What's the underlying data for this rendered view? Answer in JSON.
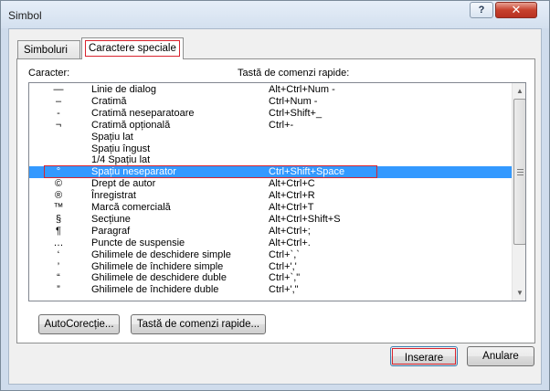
{
  "window": {
    "title": "Simbol",
    "help_label": "?",
    "close_label": "✕"
  },
  "tabs": [
    {
      "label": "Simboluri"
    },
    {
      "label": "Caractere speciale"
    }
  ],
  "columns": {
    "character": "Caracter:",
    "shortcut": "Tastă de comenzi rapide:"
  },
  "rows": [
    {
      "sym": "—",
      "name": "Linie de dialog",
      "keys": "Alt+Ctrl+Num -"
    },
    {
      "sym": "–",
      "name": "Cratimă",
      "keys": "Ctrl+Num -"
    },
    {
      "sym": "-",
      "name": "Cratimă neseparatoare",
      "keys": "Ctrl+Shift+_"
    },
    {
      "sym": "¬",
      "name": "Cratimă opțională",
      "keys": "Ctrl+-"
    },
    {
      "sym": "",
      "name": "Spațiu lat",
      "keys": ""
    },
    {
      "sym": "",
      "name": "Spațiu îngust",
      "keys": ""
    },
    {
      "sym": "",
      "name": "1/4 Spațiu lat",
      "keys": ""
    },
    {
      "sym": "°",
      "name": "Spațiu neseparator",
      "keys": "Ctrl+Shift+Space",
      "selected": true
    },
    {
      "sym": "©",
      "name": "Drept de autor",
      "keys": "Alt+Ctrl+C"
    },
    {
      "sym": "®",
      "name": "Înregistrat",
      "keys": "Alt+Ctrl+R"
    },
    {
      "sym": "™",
      "name": "Marcă comercială",
      "keys": "Alt+Ctrl+T"
    },
    {
      "sym": "§",
      "name": "Secțiune",
      "keys": "Alt+Ctrl+Shift+S"
    },
    {
      "sym": "¶",
      "name": "Paragraf",
      "keys": "Alt+Ctrl+;"
    },
    {
      "sym": "…",
      "name": "Puncte de suspensie",
      "keys": "Alt+Ctrl+."
    },
    {
      "sym": "‘",
      "name": "Ghilimele de deschidere simple",
      "keys": "Ctrl+`,`"
    },
    {
      "sym": "’",
      "name": "Ghilimele de închidere simple",
      "keys": "Ctrl+','"
    },
    {
      "sym": "“",
      "name": "Ghilimele de deschidere duble",
      "keys": "Ctrl+`,\""
    },
    {
      "sym": "”",
      "name": "Ghilimele de închidere duble",
      "keys": "Ctrl+',\""
    }
  ],
  "buttons": {
    "autocorect": "AutoCorecție...",
    "taste": "Tastă de comenzi rapide...",
    "inserare": "Inserare",
    "anulare": "Anulare"
  },
  "scrollbar": {
    "up_icon": "arrow-up-icon",
    "down_icon": "arrow-down-icon"
  }
}
